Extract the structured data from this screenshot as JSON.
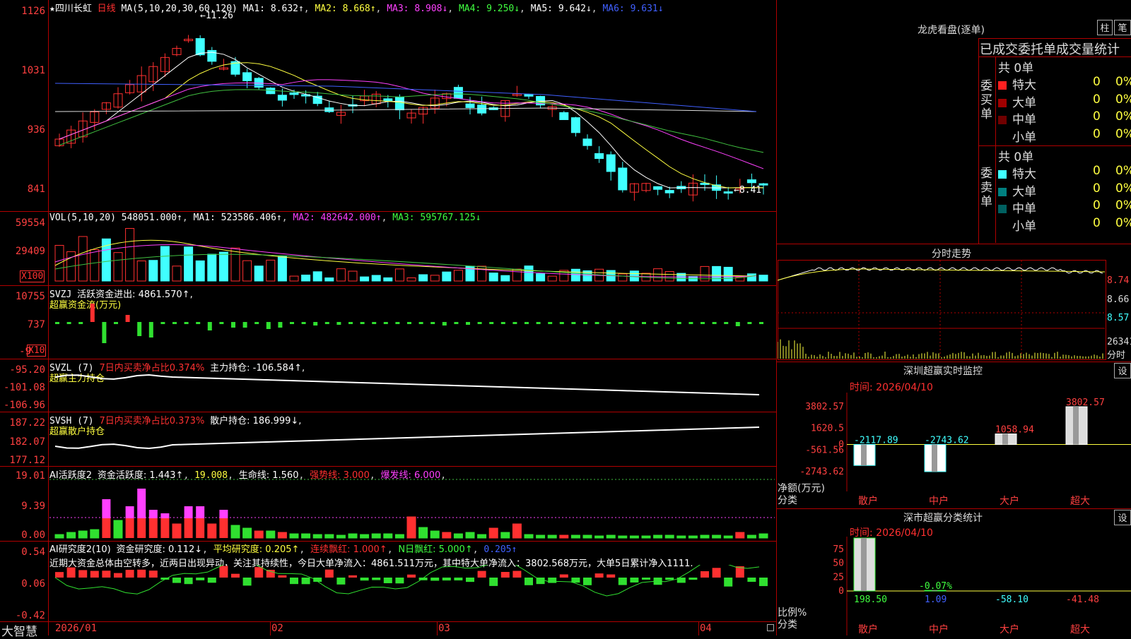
{
  "app": {
    "title_star": "★四川长虹",
    "period": "日线",
    "brand": "大智慧"
  },
  "main": {
    "ma_label": "MA(5,10,20,30,60,120)",
    "ma": [
      "MA1: 8.632↑",
      "MA2: 8.668↑",
      "MA3: 8.908↓",
      "MA4: 9.250↓",
      "MA5: 9.642↓",
      "MA6: 9.631↓"
    ],
    "yticks": [
      "1126",
      "1031",
      "936",
      "841"
    ],
    "high_label": "11.26",
    "low_label": "8.41"
  },
  "vol": {
    "label": "VOL(5,10,20)",
    "value": "548051.000↑",
    "ma": [
      "MA1: 523586.406↑",
      "MA2: 482642.000↑",
      "MA3: 595767.125↓"
    ],
    "yticks": [
      "59554",
      "29409"
    ],
    "unit": "X100"
  },
  "svzj": {
    "label": "SVZJ",
    "desc": "活跃资金进出: 4861.570↑,",
    "sub": "超赢资金流(万元)",
    "yticks": [
      "10755",
      "737",
      "-9"
    ],
    "unit": "X10"
  },
  "svzl": {
    "label": "SVZL (7)",
    "pct": "7日内买卖净占比0.374%",
    "desc": "主力持仓: -106.584↑,",
    "sub": "超赢主力持仓",
    "yticks": [
      "-95.20",
      "-101.08",
      "-106.96"
    ]
  },
  "svsh": {
    "label": "SVSH (7)",
    "pct": "7日内买卖净占比0.373%",
    "desc": "散户持仓: 186.999↓,",
    "sub": "超赢散户持仓",
    "yticks": [
      "187.22",
      "182.07",
      "177.12"
    ]
  },
  "ai1": {
    "label": "AI活跃度2",
    "v1": "资金活跃度: 1.443↑",
    "v2": "19.008",
    "v3": "生命线: 1.560",
    "v4": "强势线: 3.000",
    "v5": "爆发线: 6.000",
    "yticks": [
      "19.01",
      "9.39",
      "0.00"
    ]
  },
  "ai2": {
    "label": "AI研究度2(10)",
    "v1": "资金研究度: 0.112↓",
    "v2": "平均研究度: 0.205↑",
    "v3": "连续飘红: 1.000↑",
    "v4": "N日飘红: 5.000↑",
    "v5": "0.205↑",
    "comment": "近期大资金总体由空转多，近两日出现异动，关注其持续性，今日大单净流入：4861.511万元，其中特大单净流入：3802.568万元，大单5日累计净入1111.",
    "yticks": [
      "0.54",
      "0.06",
      "-0.42"
    ]
  },
  "xaxis": [
    "2026/01",
    "02",
    "03",
    "04"
  ],
  "lhb": {
    "title": "龙虎看盘(逐单)",
    "btn1": "柱",
    "btn2": "笔",
    "head": "已成交委托单成交量统计",
    "buy_side": "委买单",
    "sell_side": "委卖单",
    "total_buy": "共 0单",
    "total_sell": "共 0单",
    "rows": [
      {
        "label": "特大",
        "val": "0",
        "pct": "0%"
      },
      {
        "label": "大单",
        "val": "0",
        "pct": "0%"
      },
      {
        "label": "中单",
        "val": "0",
        "pct": "0%"
      },
      {
        "label": "小单",
        "val": "0",
        "pct": "0%"
      }
    ]
  },
  "intraday": {
    "title": "分时走势",
    "yticks": [
      "8.74",
      "8.66",
      "8.57"
    ],
    "vol_tick": "26341",
    "vol_unit": "分时"
  },
  "monitor": {
    "title": "深圳超赢实时监控",
    "btn": "设",
    "time": "时间: 2026/04/10",
    "yticks": [
      "3802.57",
      "1620.5",
      "0",
      "-561.56",
      "-2743.62"
    ],
    "ylabel1": "净额(万元)",
    "ylabel2": "分类",
    "chart_data": {
      "type": "bar",
      "categories": [
        "散户",
        "中户",
        "大户",
        "超大"
      ],
      "values": [
        -2117.89,
        -2743.62,
        1058.94,
        3802.57
      ],
      "value_labels": [
        "-2117.89",
        "-2743.62",
        "1058.94",
        "3802.57"
      ],
      "ylim": [
        -2743.62,
        3802.57
      ]
    }
  },
  "classify": {
    "title": "深市超赢分类统计",
    "btn": "设",
    "time": "时间: 2026/04/10",
    "yticks": [
      "75",
      "50",
      "25",
      "0"
    ],
    "ylabel1": "比例%",
    "ylabel2": "分类",
    "chart_data": {
      "type": "bar",
      "categories": [
        "散户",
        "中户",
        "大户",
        "超大"
      ],
      "values": [
        198.5,
        1.09,
        -58.1,
        -41.48
      ],
      "value_labels": [
        "198.50",
        "1.09",
        "-58.10",
        "-41.48"
      ],
      "extra_label": "-0.07%"
    }
  },
  "colors": {
    "up": "#ff3030",
    "down": "#40ffff",
    "grid": "#b00000"
  }
}
